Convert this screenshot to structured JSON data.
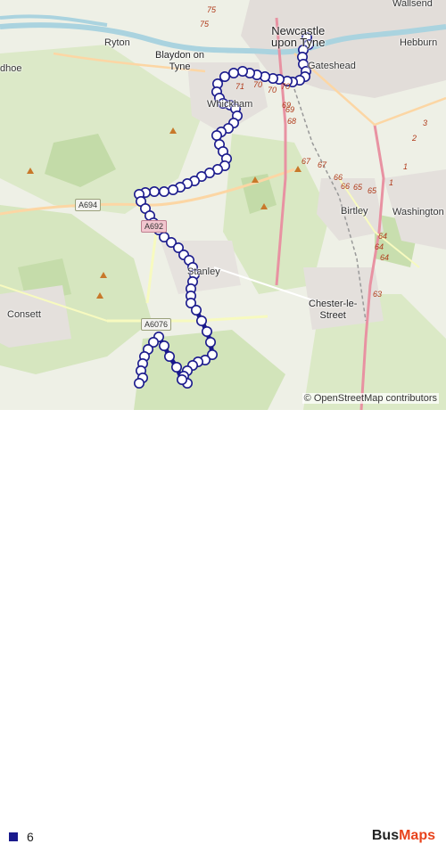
{
  "map": {
    "labels": {
      "wallsend": "Wallsend",
      "newcastle_line1": "Newcastle",
      "newcastle_line2": "upon Tyne",
      "gateshead": "Gateshead",
      "hebburn": "Hebburn",
      "ryton": "Ryton",
      "blaydon_line1": "Blaydon on",
      "blaydon_line2": "Tyne",
      "whickham": "Whickham",
      "hoe": "dhoe",
      "birtley": "Birtley",
      "washington": "Washington",
      "stanley": "Stanley",
      "chester_line1": "Chester-le-",
      "chester_line2": "Street",
      "consett": "Consett"
    },
    "road_shields": {
      "a694": "A694",
      "a692": "A692",
      "a6076": "A6076"
    },
    "road_numbers": [
      "75",
      "75",
      "70",
      "71",
      "70",
      "70",
      "69",
      "69",
      "68",
      "67",
      "67",
      "66",
      "66",
      "65",
      "65",
      "64",
      "64",
      "64",
      "63",
      "3",
      "2",
      "1",
      "1"
    ],
    "attribution": "© OpenStreetMap contributors"
  },
  "route": {
    "color": "#1a1a8c",
    "stop_color": "#ffffff"
  },
  "legend": {
    "route_name": "6",
    "color": "#1a1a8c"
  },
  "brand": {
    "part1": "Bus",
    "part2": "Maps",
    "color1": "#222222",
    "color2": "#e8431c"
  }
}
